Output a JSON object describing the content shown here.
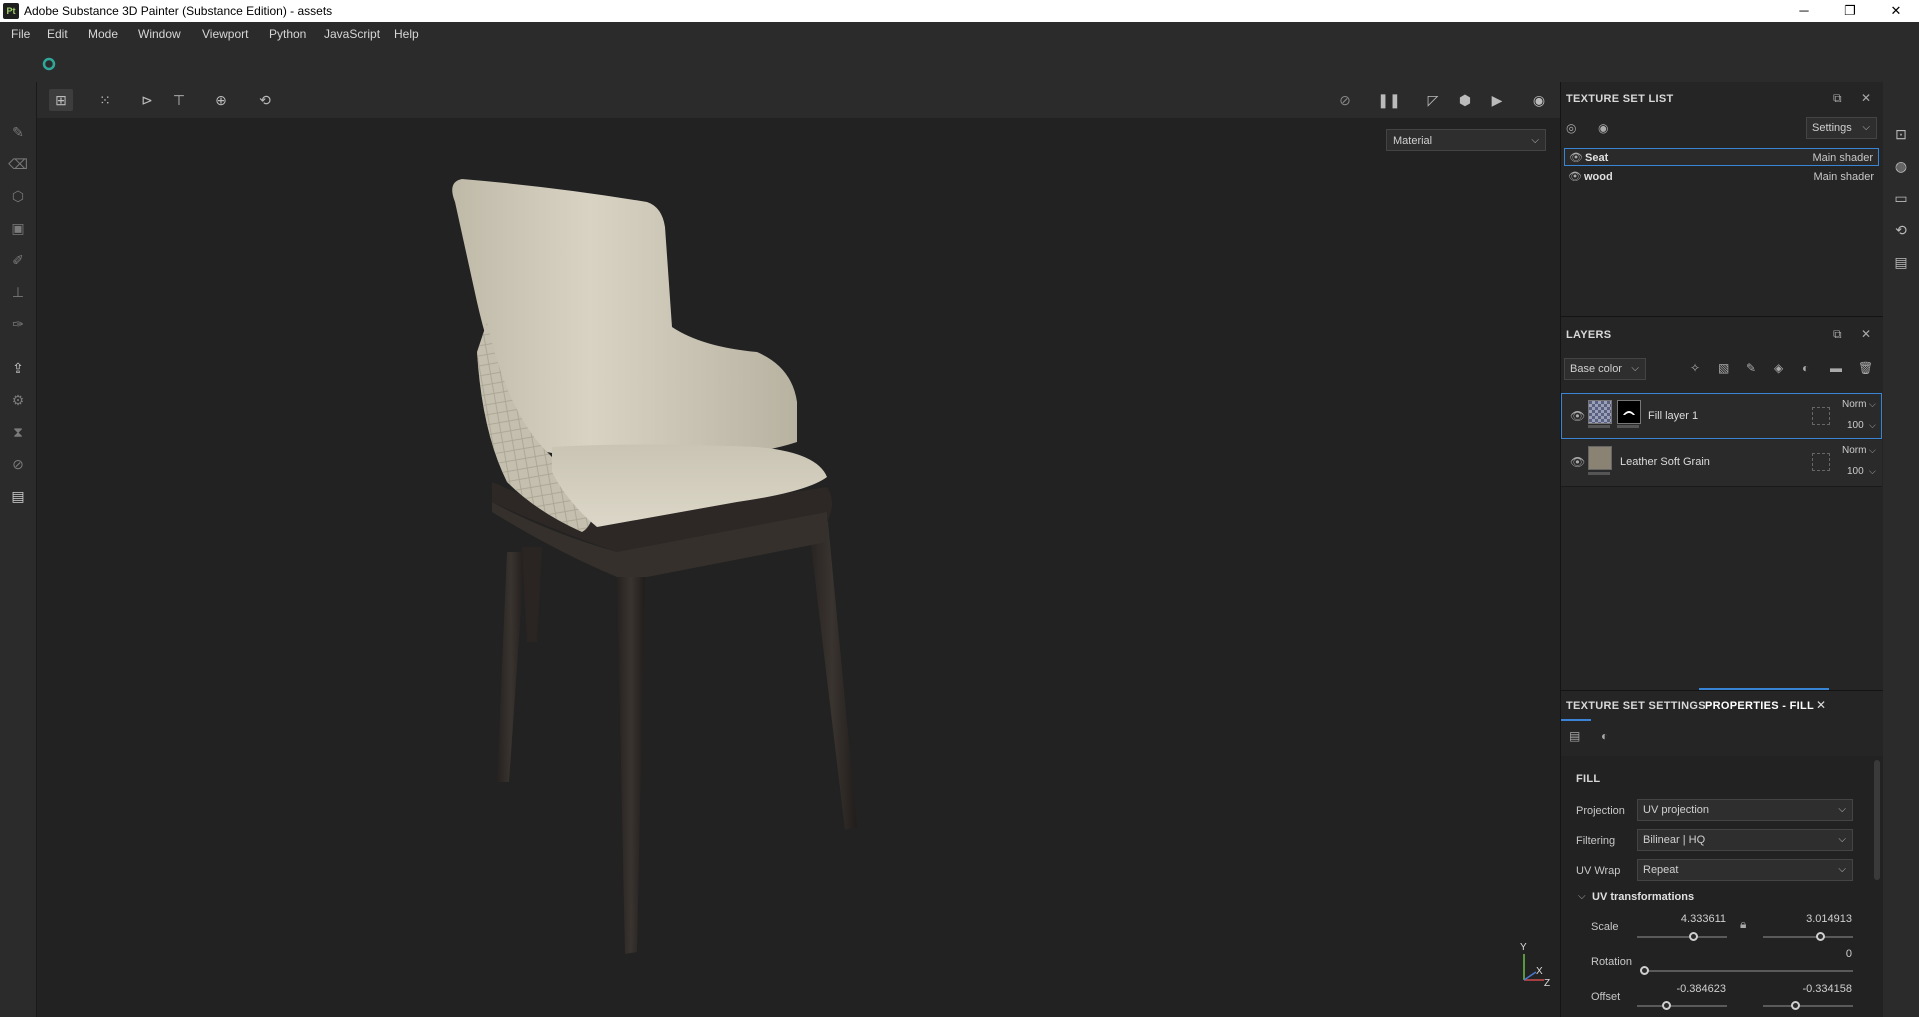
{
  "window": {
    "title": "Adobe Substance 3D Painter (Substance Edition) - assets",
    "logo_text": "Pt",
    "minimize": "─",
    "maximize": "❐",
    "close": "✕"
  },
  "menu": [
    "File",
    "Edit",
    "Mode",
    "Window",
    "Viewport",
    "Python",
    "JavaScript",
    "Help"
  ],
  "viewport": {
    "material_mode": "Material",
    "axis_y": "Y",
    "axis_x": "X",
    "axis_z": "Z"
  },
  "texture_set_list": {
    "title": "TEXTURE SET LIST",
    "settings_label": "Settings",
    "items": [
      {
        "name": "Seat",
        "shader": "Main shader"
      },
      {
        "name": "wood",
        "shader": "Main shader"
      }
    ]
  },
  "layers": {
    "title": "LAYERS",
    "channel": "Base color",
    "items": [
      {
        "name": "Fill layer 1",
        "blend": "Norm",
        "opacity": "100"
      },
      {
        "name": "Leather Soft Grain",
        "blend": "Norm",
        "opacity": "100"
      }
    ]
  },
  "properties": {
    "tab_texture_set_settings": "TEXTURE SET SETTINGS",
    "tab_properties_fill": "PROPERTIES - FILL",
    "section": "FILL",
    "projection_label": "Projection",
    "projection_value": "UV projection",
    "filtering_label": "Filtering",
    "filtering_value": "Bilinear | HQ",
    "uvwrap_label": "UV Wrap",
    "uvwrap_value": "Repeat",
    "uv_transform_title": "UV transformations",
    "scale_label": "Scale",
    "scale_u": "4.333611",
    "scale_v": "3.014913",
    "rotation_label": "Rotation",
    "rotation_value": "0",
    "offset_label": "Offset",
    "offset_u": "-0.384623",
    "offset_v": "-0.334158"
  },
  "colors": {
    "accent": "#3a84d6",
    "seat": "#d7d2c2",
    "frame": "#2f2a27"
  }
}
